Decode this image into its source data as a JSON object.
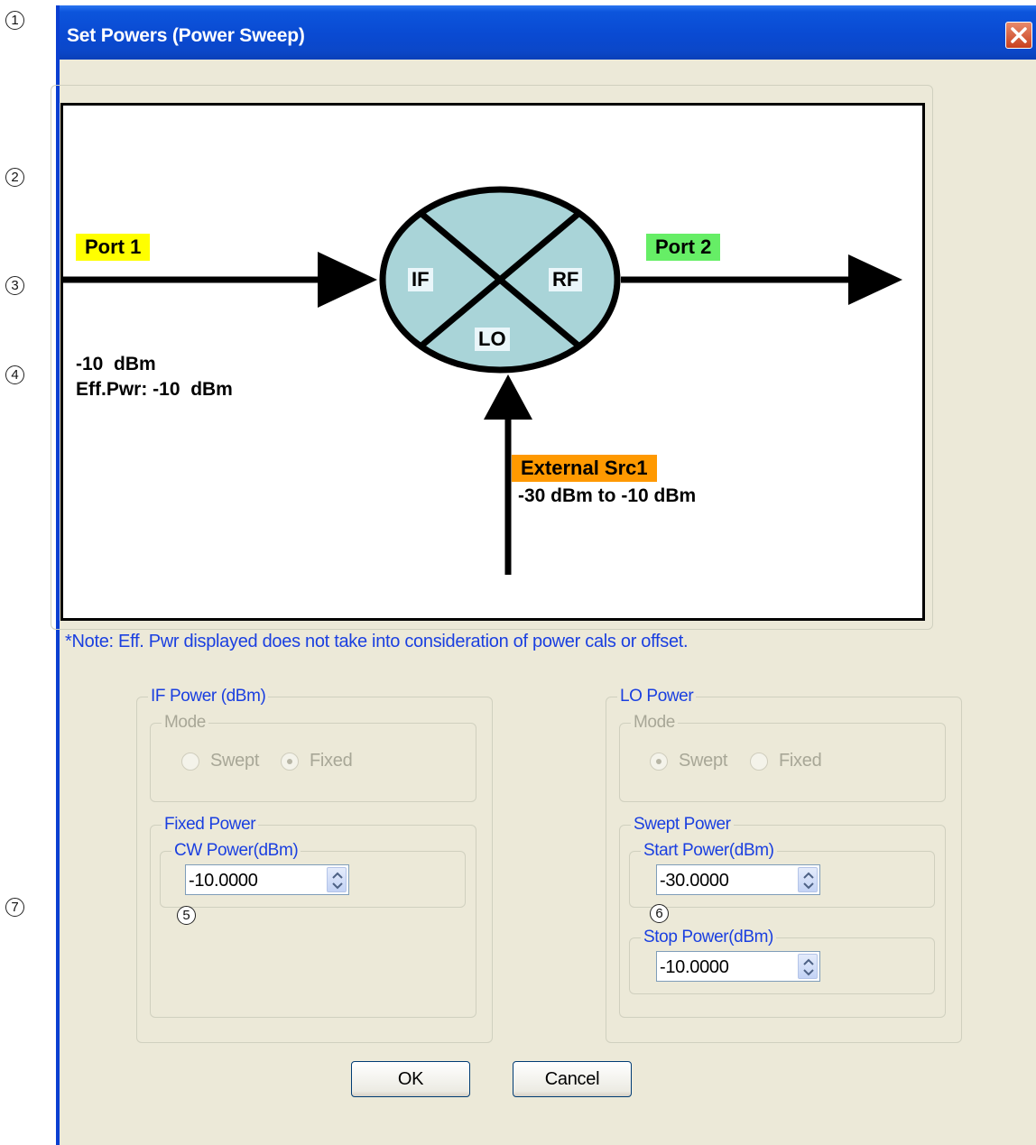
{
  "callouts": [
    "1",
    "2",
    "3",
    "4",
    "5",
    "6",
    "7"
  ],
  "window": {
    "title": "Set Powers (Power Sweep)",
    "close_icon": "close-icon"
  },
  "diagram": {
    "port1_label": "Port 1",
    "port2_label": "Port 2",
    "mixer_if": "IF",
    "mixer_rf": "RF",
    "mixer_lo": "LO",
    "port1_power": "-10  dBm",
    "port1_eff_power": "Eff.Pwr: -10  dBm",
    "external_src_label": "External Src1",
    "external_src_power": "-30 dBm to -10 dBm",
    "colors": {
      "port1": "#ffff00",
      "port2": "#66ee66",
      "external": "#ff9900",
      "mixer": "#a9d4d8"
    }
  },
  "note": "*Note: Eff. Pwr displayed does not take into consideration of power cals or offset.",
  "if_power": {
    "legend": "IF Power (dBm)",
    "mode_legend": "Mode",
    "options": [
      "Swept",
      "Fixed"
    ],
    "selected": "Fixed",
    "fixed_legend": "Fixed Power",
    "cw_legend": "CW Power(dBm)",
    "cw_value": "-10.0000"
  },
  "lo_power": {
    "legend": "LO Power",
    "mode_legend": "Mode",
    "options": [
      "Swept",
      "Fixed"
    ],
    "selected": "Swept",
    "swept_legend": "Swept Power",
    "start_legend": "Start Power(dBm)",
    "start_value": "-30.0000",
    "stop_legend": "Stop Power(dBm)",
    "stop_value": "-10.0000"
  },
  "buttons": {
    "ok": "OK",
    "cancel": "Cancel"
  }
}
